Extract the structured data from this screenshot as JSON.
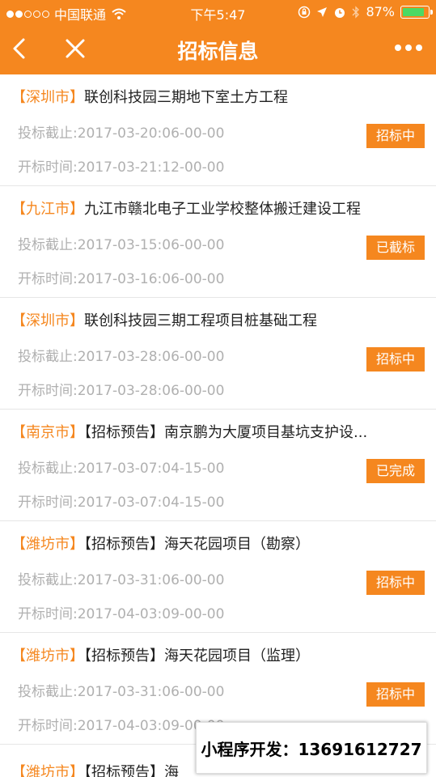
{
  "status_bar": {
    "carrier": "中国联通",
    "time": "下午5:47",
    "battery": "87%"
  },
  "nav": {
    "title": "招标信息"
  },
  "colors": {
    "accent": "#f5871f",
    "meta_text": "#b0b0b0",
    "title_text": "#222222"
  },
  "items": [
    {
      "city": "【深圳市】",
      "name": "联创科技园三期地下室土方工程",
      "deadline": "投标截止:2017-03-20:06-00-00",
      "open": "开标时间:2017-03-21:12-00-00",
      "status": "招标中"
    },
    {
      "city": "【九江市】",
      "name": "九江市赣北电子工业学校整体搬迁建设工程",
      "deadline": "投标截止:2017-03-15:06-00-00",
      "open": "开标时间:2017-03-16:06-00-00",
      "status": "已截标"
    },
    {
      "city": "【深圳市】",
      "name": "联创科技园三期工程项目桩基础工程",
      "deadline": "投标截止:2017-03-28:06-00-00",
      "open": "开标时间:2017-03-28:06-00-00",
      "status": "招标中"
    },
    {
      "city": "【南京市】",
      "name": "【招标预告】南京鹏为大厦项目基坑支护设...",
      "deadline": "投标截止:2017-03-07:04-15-00",
      "open": "开标时间:2017-03-07:04-15-00",
      "status": "已完成"
    },
    {
      "city": "【潍坊市】",
      "name": "【招标预告】海天花园项目（勘察）",
      "deadline": "投标截止:2017-03-31:06-00-00",
      "open": "开标时间:2017-04-03:09-00-00",
      "status": "招标中"
    },
    {
      "city": "【潍坊市】",
      "name": "【招标预告】海天花园项目（监理）",
      "deadline": "投标截止:2017-03-31:06-00-00",
      "open": "开标时间:2017-04-03:09-00-00",
      "status": "招标中"
    },
    {
      "city": "【潍坊市】",
      "name": "【招标预告】海",
      "deadline": "",
      "open": "",
      "status": ""
    }
  ],
  "watermark": "小程序开发：13691612727"
}
